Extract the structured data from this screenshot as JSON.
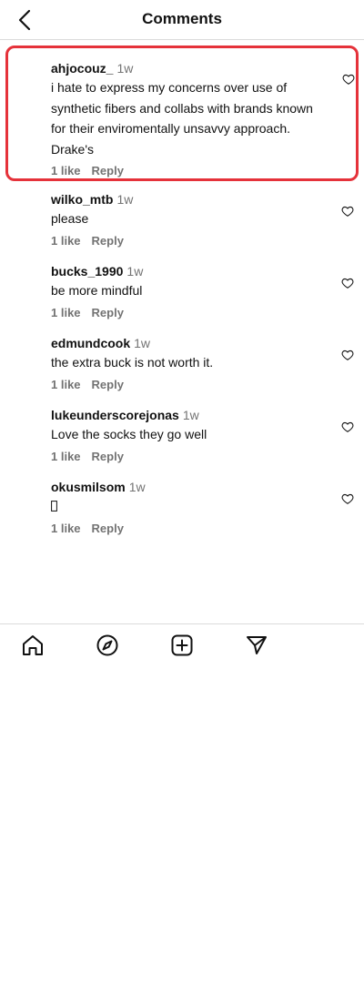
{
  "header": {
    "title": "Comments",
    "back_icon": "chevron-left-icon"
  },
  "comments": [
    {
      "username": "ahjocouz_",
      "time": "1w",
      "text": "i hate to express my concerns over use of synthetic fibers and collabs with brands known for their enviromentally unsavvy approach. Drake's",
      "likes": "1 like",
      "reply": "Reply",
      "highlighted": true,
      "highlight_color": "#e5323a"
    },
    {
      "username": "wilko_mtb",
      "time": "1w",
      "text": "please",
      "likes": "1 like",
      "reply": "Reply"
    },
    {
      "username": "bucks_1990",
      "time": "1w",
      "text": "be more mindful",
      "likes": "1 like",
      "reply": "Reply"
    },
    {
      "username": "edmundcook",
      "time": "1w",
      "text": "the extra buck is not worth it.",
      "likes": "1 like",
      "reply": "Reply"
    },
    {
      "username": "lukeunderscorejonas",
      "time": "1w",
      "text": "Love the socks they go well",
      "likes": "1 like",
      "reply": "Reply"
    },
    {
      "username": "okusmilsom",
      "time": "1w",
      "text": "",
      "likes": "1 like",
      "reply": "Reply"
    }
  ],
  "bottom_nav": [
    {
      "icon": "home-icon"
    },
    {
      "icon": "explore-compass-icon"
    },
    {
      "icon": "new-post-plus-icon"
    },
    {
      "icon": "send-paper-plane-icon"
    }
  ]
}
